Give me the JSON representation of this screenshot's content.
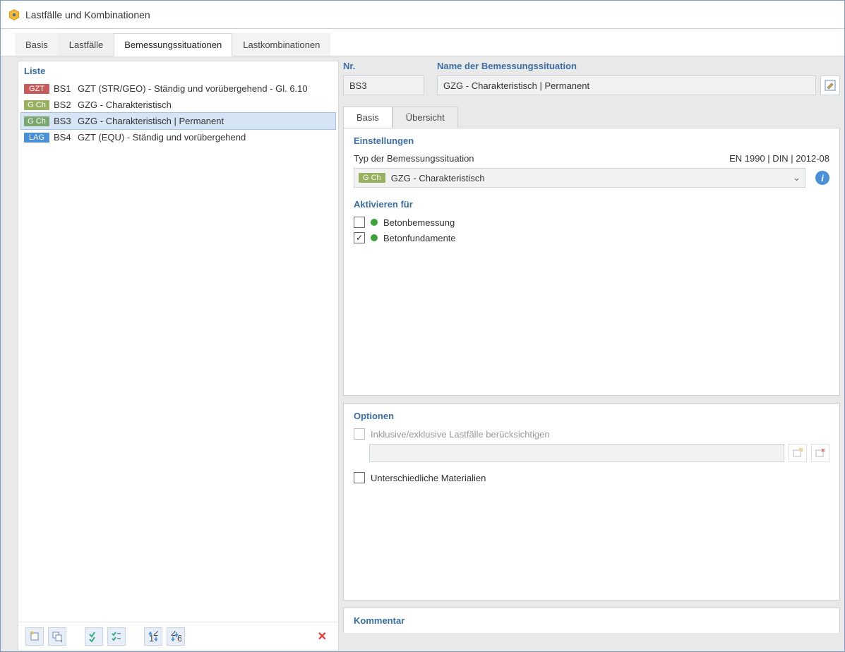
{
  "window": {
    "title": "Lastfälle und Kombinationen"
  },
  "tabs": {
    "basis": "Basis",
    "lastfaelle": "Lastfälle",
    "bemessung": "Bemessungssituationen",
    "lastkomb": "Lastkombinationen"
  },
  "left": {
    "header": "Liste",
    "items": [
      {
        "tag": "GZT",
        "tagcls": "tag-gzt",
        "num": "BS1",
        "desc": "GZT (STR/GEO) - Ständig und vorübergehend - Gl. 6.10"
      },
      {
        "tag": "G Ch",
        "tagcls": "tag-gch",
        "num": "BS2",
        "desc": "GZG - Charakteristisch"
      },
      {
        "tag": "G Ch",
        "tagcls": "tag-gch-sel",
        "num": "BS3",
        "desc": "GZG - Charakteristisch | Permanent"
      },
      {
        "tag": "LAG",
        "tagcls": "tag-lag",
        "num": "BS4",
        "desc": "GZT (EQU) - Ständig und vorübergehend"
      }
    ],
    "selected_index": 2
  },
  "right": {
    "nr_label": "Nr.",
    "nr_value": "BS3",
    "name_label": "Name der Bemessungssituation",
    "name_value": "GZG - Charakteristisch | Permanent",
    "subtabs": {
      "basis": "Basis",
      "uebersicht": "Übersicht"
    },
    "settings": {
      "title": "Einstellungen",
      "type_label": "Typ der Bemessungssituation",
      "norm": "EN 1990 | DIN | 2012-08",
      "type_tag": "G Ch",
      "type_value": "GZG - Charakteristisch"
    },
    "activate": {
      "title": "Aktivieren für",
      "items": [
        {
          "label": "Betonbemessung",
          "checked": false
        },
        {
          "label": "Betonfundamente",
          "checked": true
        }
      ]
    },
    "options": {
      "title": "Optionen",
      "inclexcl": "Inklusive/exklusive Lastfälle berücksichtigen",
      "diffmat": "Unterschiedliche Materialien"
    },
    "comment": {
      "title": "Kommentar"
    }
  }
}
